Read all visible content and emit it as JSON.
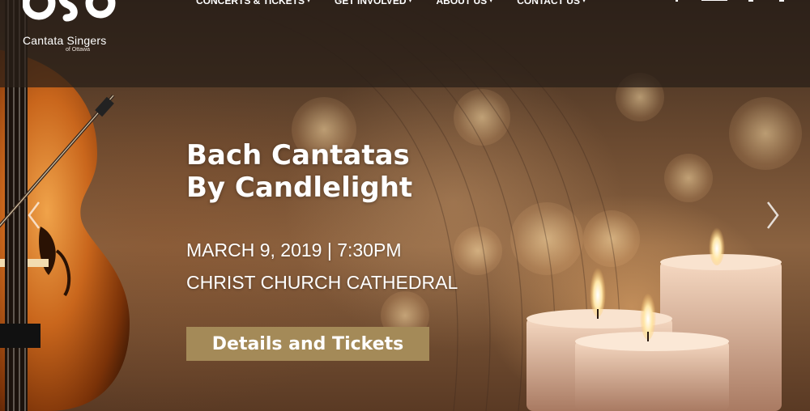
{
  "brand": {
    "logo_text": "CSO",
    "name": "Cantata Singers",
    "subname": "of Ottawa"
  },
  "nav": {
    "items": [
      {
        "label": "CONCERTS & TICKETS"
      },
      {
        "label": "GET INVOLVED"
      },
      {
        "label": "ABOUT US"
      },
      {
        "label": "CONTACT US"
      }
    ],
    "caret": "▾"
  },
  "hero": {
    "title_line1": "Bach Cantatas",
    "title_line2": "By Candlelight",
    "date": "MARCH 9, 2019 | 7:30PM",
    "venue": "CHRIST CHURCH CATHEDRAL",
    "cta_label": "Details and Tickets"
  },
  "slider": {
    "prev_icon": "chevron-left-icon",
    "next_icon": "chevron-right-icon"
  },
  "colors": {
    "header_bg": "rgba(40,30,24,0.72)",
    "cta_bg": "#a48a58",
    "text": "#ffffff"
  }
}
